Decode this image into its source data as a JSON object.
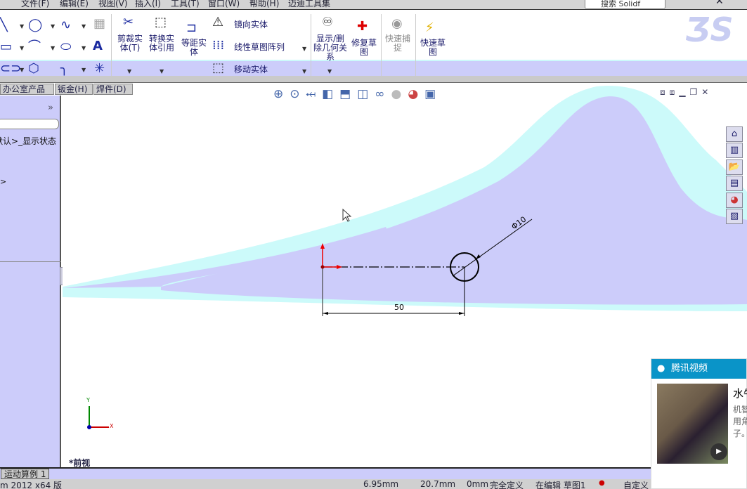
{
  "menu": [
    "文件(F)",
    "编辑(E)",
    "视图(V)",
    "插入(I)",
    "工具(T)",
    "窗口(W)",
    "帮助(H)",
    "迈迪工具集"
  ],
  "search": {
    "placeholder": "搜索 Solidf"
  },
  "toolbar": {
    "trim": "剪裁实体(T)",
    "convert": "转换实体引用",
    "offset": "等距实体",
    "mirror": "镜向实体",
    "linear_pattern": "线性草图阵列",
    "move": "移动实体",
    "display_delete": "显示/删除几何关系",
    "repair": "修复草图",
    "quick_snap": "快速捕捉",
    "rapid_sketch": "快速草图"
  },
  "tabs": [
    "办公室产品",
    "钣金(H)",
    "焊件(D)"
  ],
  "left_panel": {
    "expand": "»",
    "display_state": "默认>_显示状态",
    "item2": ">"
  },
  "sketch": {
    "dimension_length": "50",
    "dimension_diameter": "Φ10",
    "view_label": "*前视",
    "axis_x": "X",
    "axis_y": "Y"
  },
  "bottom_tab": "运动算例 1",
  "status": {
    "version": "m 2012 x64 版",
    "x": "6.95mm",
    "y": "20.7mm",
    "z": "0mm",
    "state": "完全定义",
    "editing": "在编辑 草图1",
    "custom": "自定义"
  },
  "popup": {
    "title": "腾讯视频",
    "headline": "水牛",
    "desc": "机智\n用角\n子。"
  },
  "colors": {
    "background_lavender": "#ccccfa",
    "background_cyan": "#ccfafa",
    "sketch_origin": "#e00000",
    "popup_header": "#0a94c8"
  }
}
